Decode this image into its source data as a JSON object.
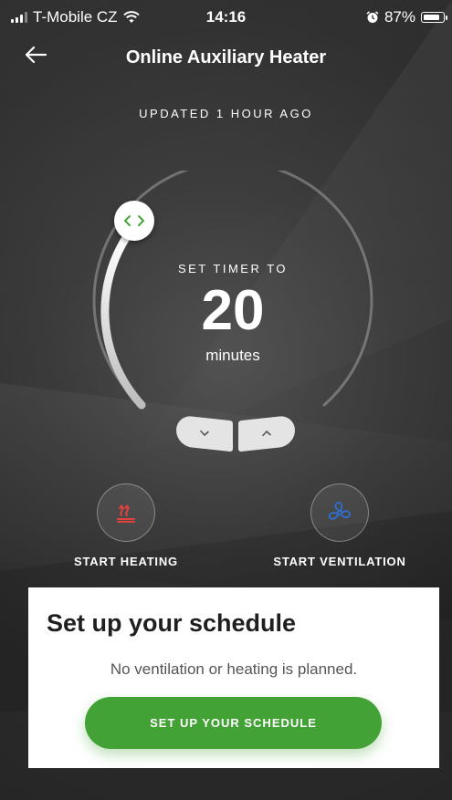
{
  "status_bar": {
    "carrier": "T-Mobile CZ",
    "time": "14:16",
    "battery": "87%",
    "battery_level": 0.87
  },
  "header": {
    "title": "Online Auxiliary Heater"
  },
  "updated_text": "UPDATED 1 HOUR AGO",
  "timer": {
    "label": "SET TIMER TO",
    "value": "20",
    "unit": "minutes",
    "level": 0.33
  },
  "actions": {
    "heating_label": "START HEATING",
    "ventilation_label": "START VENTILATION"
  },
  "schedule": {
    "title": "Set up your schedule",
    "subtitle": "No ventilation or heating is planned.",
    "button_label": "SET UP YOUR SCHEDULE"
  },
  "colors": {
    "accent_green": "#43a236",
    "heating_red": "#e0423e",
    "ventilation_blue": "#2f6fd0",
    "knob_arrows": "#45a63a"
  }
}
